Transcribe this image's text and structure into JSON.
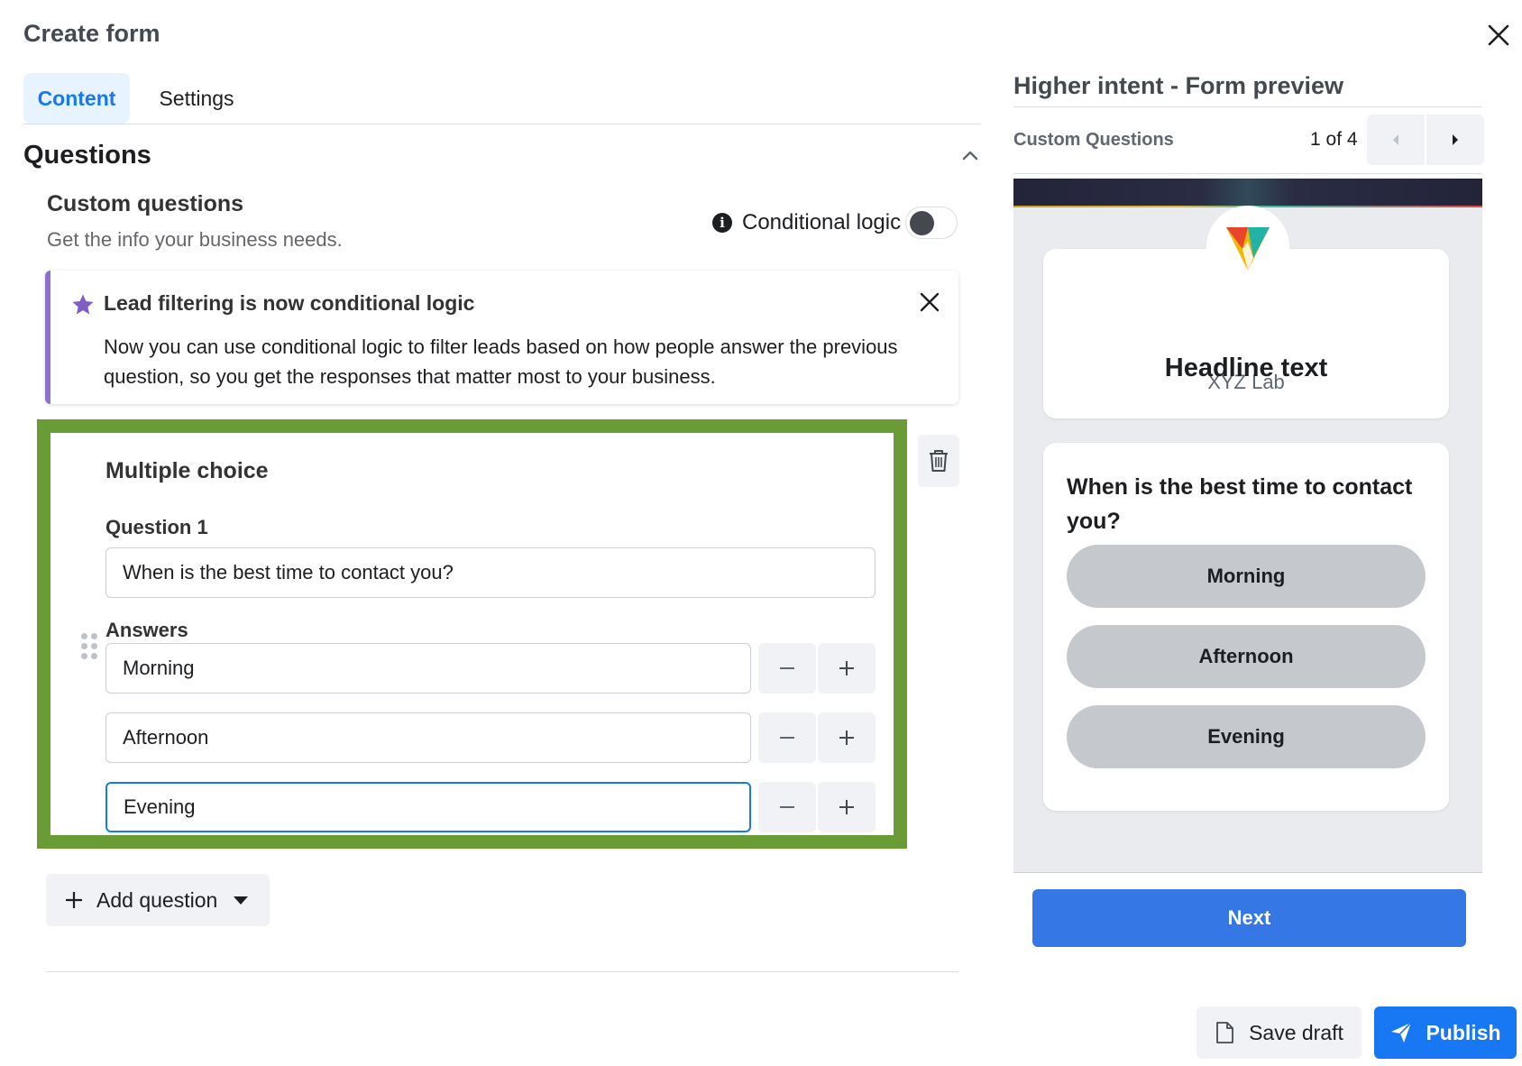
{
  "dialog": {
    "title": "Create form"
  },
  "tabs": [
    {
      "label": "Content",
      "active": true
    },
    {
      "label": "Settings",
      "active": false
    }
  ],
  "section": {
    "title": "Questions"
  },
  "custom_questions": {
    "title": "Custom questions",
    "subtitle": "Get the info your business needs.",
    "conditional_logic_label": "Conditional logic",
    "conditional_logic_enabled": false
  },
  "notice": {
    "title": "Lead filtering is now conditional logic",
    "body": "Now you can use conditional logic to filter leads based on how people answer the previous question, so you get the responses that matter most to your business."
  },
  "question_card": {
    "type": "Multiple choice",
    "question_label": "Question 1",
    "question_value": "When is the best time to contact you?",
    "answers_label": "Answers",
    "answers": [
      "Morning",
      "Afternoon",
      "Evening"
    ],
    "focused_answer_index": 2
  },
  "add_question": {
    "label": "Add question"
  },
  "preview": {
    "title": "Higher intent - Form preview",
    "subtitle": "Custom Questions",
    "page_indicator": "1 of 4",
    "brand_name": "XYZ Lab",
    "headline": "Headline text",
    "question": "When is the best time to contact you?",
    "options": [
      "Morning",
      "Afternoon",
      "Evening"
    ],
    "next_label": "Next"
  },
  "footer": {
    "save_draft_label": "Save draft",
    "publish_label": "Publish"
  },
  "colors": {
    "accent": "#1877f2",
    "highlight_border": "#6a9c36",
    "notice_border": "#8c72cb",
    "next_button": "#3578e5"
  },
  "icons": {
    "close": "close-icon",
    "collapse": "chevron-up-icon",
    "info": "info-icon",
    "star": "star-icon",
    "drag": "drag-handle-icon",
    "trash": "trash-icon",
    "minus": "minus-icon",
    "plus": "plus-icon",
    "caret": "caret-down-icon",
    "prev": "chevron-left-icon",
    "next": "chevron-right-icon",
    "document": "document-icon",
    "send": "send-icon",
    "logo": "brand-logo-icon"
  }
}
